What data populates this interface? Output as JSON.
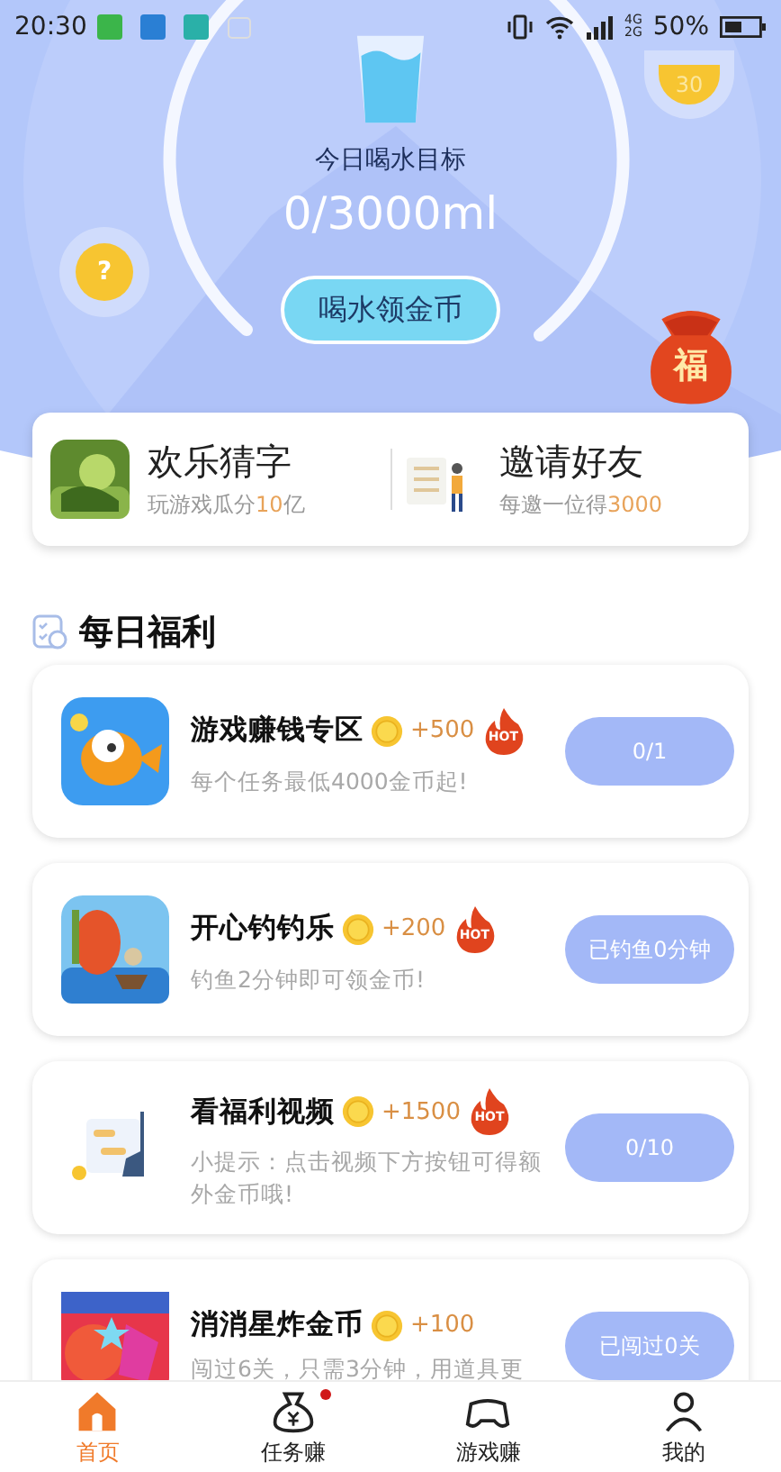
{
  "status_bar": {
    "time": "20:30",
    "network_top": "4G",
    "network_bottom": "2G",
    "battery": "50%"
  },
  "header": {
    "bonus_bubble": "30",
    "help": "?",
    "goal_label": "今日喝水目标",
    "progress": "0/3000ml",
    "button": "喝水领金币",
    "lucky_bag": "福"
  },
  "promos": [
    {
      "kind": "game",
      "title": "欢乐猜字",
      "subtitle": "玩游戏瓜分",
      "highlight": "10",
      "suffix": "亿"
    },
    {
      "kind": "invite",
      "title": "邀请好友",
      "subtitle": "每邀一位得",
      "highlight": "3000"
    }
  ],
  "section": {
    "title": "每日福利"
  },
  "tasks": [
    {
      "kind": "fish",
      "title": "游戏赚钱专区",
      "reward": "+500",
      "hot": "HOT",
      "description": "每个任务最低4000金币起!",
      "button": "0/1"
    },
    {
      "kind": "fishing",
      "title": "开心钓钓乐",
      "reward": "+200",
      "hot": "HOT",
      "description": "钓鱼2分钟即可领金币!",
      "button": "已钓鱼0分钟"
    },
    {
      "kind": "video",
      "title": "看福利视频",
      "reward": "+1500",
      "hot": "HOT",
      "description": "小提示：点击视频下方按钮可得额外金币哦!",
      "button": "0/10"
    },
    {
      "kind": "candy",
      "title": "消消星炸金币",
      "reward": "+100",
      "description": "闯过6关，只需3分钟，用道具更",
      "button": "已闯过0关"
    }
  ],
  "tabs": [
    {
      "label": "首页",
      "selected": true,
      "dot": false
    },
    {
      "label": "任务赚",
      "selected": false,
      "dot": true
    },
    {
      "label": "游戏赚",
      "selected": false,
      "dot": false
    },
    {
      "label": "我的",
      "selected": false,
      "dot": false
    }
  ]
}
